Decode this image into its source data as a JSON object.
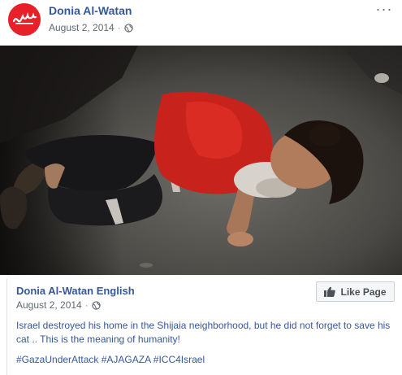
{
  "header": {
    "page_name": "Donia Al-Watan",
    "date": "August 2, 2014",
    "separator": "·",
    "privacy_icon": "globe-icon",
    "more_icon": "more-options-icon",
    "more_label": "···"
  },
  "photo": {
    "icon": "post-photo"
  },
  "shared": {
    "page_name": "Donia Al-Watan English",
    "date": "August 2, 2014",
    "separator": "·",
    "like_button_label": "Like Page",
    "text": "Israel destroyed his home in the Shijaia neighborhood, but he did not forget to save his cat .. This is the meaning of humanity!",
    "hashtags": [
      "#GazaUnderAttack",
      "#AJAGAZA",
      "#ICC4Israel"
    ]
  },
  "colors": {
    "link_blue": "#365899",
    "meta_gray": "#616770",
    "avatar_red": "#e8202a",
    "button_bg": "#f5f6f7"
  }
}
